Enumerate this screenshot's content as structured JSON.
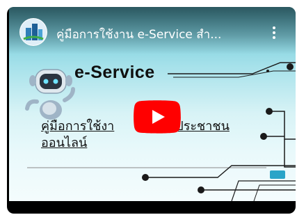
{
  "video": {
    "title": "คู่มือการใช้งาน e-Service สำ...",
    "thumbnail": {
      "heading": "e-Service",
      "manual_line1": "คู่มือการใช้งา",
      "manual_line1_tail": "ประชาชน",
      "manual_line2": "ออนไลน์"
    }
  },
  "controls": {
    "play_icon": "play-icon",
    "more_icon": "more-vert-icon"
  },
  "colors": {
    "play_red": "#ff0000",
    "accent_teal": "#2aa4c8"
  }
}
